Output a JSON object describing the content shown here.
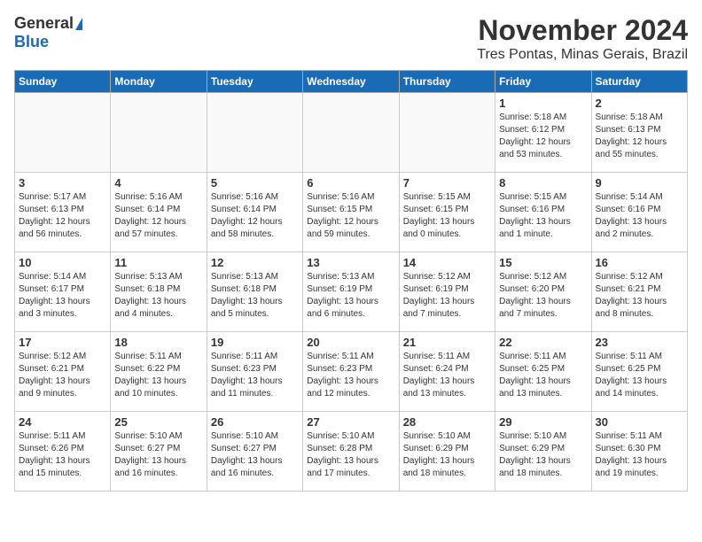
{
  "logo": {
    "general": "General",
    "blue": "Blue"
  },
  "header": {
    "month": "November 2024",
    "location": "Tres Pontas, Minas Gerais, Brazil"
  },
  "weekdays": [
    "Sunday",
    "Monday",
    "Tuesday",
    "Wednesday",
    "Thursday",
    "Friday",
    "Saturday"
  ],
  "weeks": [
    [
      {
        "day": "",
        "info": ""
      },
      {
        "day": "",
        "info": ""
      },
      {
        "day": "",
        "info": ""
      },
      {
        "day": "",
        "info": ""
      },
      {
        "day": "",
        "info": ""
      },
      {
        "day": "1",
        "info": "Sunrise: 5:18 AM\nSunset: 6:12 PM\nDaylight: 12 hours\nand 53 minutes."
      },
      {
        "day": "2",
        "info": "Sunrise: 5:18 AM\nSunset: 6:13 PM\nDaylight: 12 hours\nand 55 minutes."
      }
    ],
    [
      {
        "day": "3",
        "info": "Sunrise: 5:17 AM\nSunset: 6:13 PM\nDaylight: 12 hours\nand 56 minutes."
      },
      {
        "day": "4",
        "info": "Sunrise: 5:16 AM\nSunset: 6:14 PM\nDaylight: 12 hours\nand 57 minutes."
      },
      {
        "day": "5",
        "info": "Sunrise: 5:16 AM\nSunset: 6:14 PM\nDaylight: 12 hours\nand 58 minutes."
      },
      {
        "day": "6",
        "info": "Sunrise: 5:16 AM\nSunset: 6:15 PM\nDaylight: 12 hours\nand 59 minutes."
      },
      {
        "day": "7",
        "info": "Sunrise: 5:15 AM\nSunset: 6:15 PM\nDaylight: 13 hours\nand 0 minutes."
      },
      {
        "day": "8",
        "info": "Sunrise: 5:15 AM\nSunset: 6:16 PM\nDaylight: 13 hours\nand 1 minute."
      },
      {
        "day": "9",
        "info": "Sunrise: 5:14 AM\nSunset: 6:16 PM\nDaylight: 13 hours\nand 2 minutes."
      }
    ],
    [
      {
        "day": "10",
        "info": "Sunrise: 5:14 AM\nSunset: 6:17 PM\nDaylight: 13 hours\nand 3 minutes."
      },
      {
        "day": "11",
        "info": "Sunrise: 5:13 AM\nSunset: 6:18 PM\nDaylight: 13 hours\nand 4 minutes."
      },
      {
        "day": "12",
        "info": "Sunrise: 5:13 AM\nSunset: 6:18 PM\nDaylight: 13 hours\nand 5 minutes."
      },
      {
        "day": "13",
        "info": "Sunrise: 5:13 AM\nSunset: 6:19 PM\nDaylight: 13 hours\nand 6 minutes."
      },
      {
        "day": "14",
        "info": "Sunrise: 5:12 AM\nSunset: 6:19 PM\nDaylight: 13 hours\nand 7 minutes."
      },
      {
        "day": "15",
        "info": "Sunrise: 5:12 AM\nSunset: 6:20 PM\nDaylight: 13 hours\nand 7 minutes."
      },
      {
        "day": "16",
        "info": "Sunrise: 5:12 AM\nSunset: 6:21 PM\nDaylight: 13 hours\nand 8 minutes."
      }
    ],
    [
      {
        "day": "17",
        "info": "Sunrise: 5:12 AM\nSunset: 6:21 PM\nDaylight: 13 hours\nand 9 minutes."
      },
      {
        "day": "18",
        "info": "Sunrise: 5:11 AM\nSunset: 6:22 PM\nDaylight: 13 hours\nand 10 minutes."
      },
      {
        "day": "19",
        "info": "Sunrise: 5:11 AM\nSunset: 6:23 PM\nDaylight: 13 hours\nand 11 minutes."
      },
      {
        "day": "20",
        "info": "Sunrise: 5:11 AM\nSunset: 6:23 PM\nDaylight: 13 hours\nand 12 minutes."
      },
      {
        "day": "21",
        "info": "Sunrise: 5:11 AM\nSunset: 6:24 PM\nDaylight: 13 hours\nand 13 minutes."
      },
      {
        "day": "22",
        "info": "Sunrise: 5:11 AM\nSunset: 6:25 PM\nDaylight: 13 hours\nand 13 minutes."
      },
      {
        "day": "23",
        "info": "Sunrise: 5:11 AM\nSunset: 6:25 PM\nDaylight: 13 hours\nand 14 minutes."
      }
    ],
    [
      {
        "day": "24",
        "info": "Sunrise: 5:11 AM\nSunset: 6:26 PM\nDaylight: 13 hours\nand 15 minutes."
      },
      {
        "day": "25",
        "info": "Sunrise: 5:10 AM\nSunset: 6:27 PM\nDaylight: 13 hours\nand 16 minutes."
      },
      {
        "day": "26",
        "info": "Sunrise: 5:10 AM\nSunset: 6:27 PM\nDaylight: 13 hours\nand 16 minutes."
      },
      {
        "day": "27",
        "info": "Sunrise: 5:10 AM\nSunset: 6:28 PM\nDaylight: 13 hours\nand 17 minutes."
      },
      {
        "day": "28",
        "info": "Sunrise: 5:10 AM\nSunset: 6:29 PM\nDaylight: 13 hours\nand 18 minutes."
      },
      {
        "day": "29",
        "info": "Sunrise: 5:10 AM\nSunset: 6:29 PM\nDaylight: 13 hours\nand 18 minutes."
      },
      {
        "day": "30",
        "info": "Sunrise: 5:11 AM\nSunset: 6:30 PM\nDaylight: 13 hours\nand 19 minutes."
      }
    ]
  ]
}
